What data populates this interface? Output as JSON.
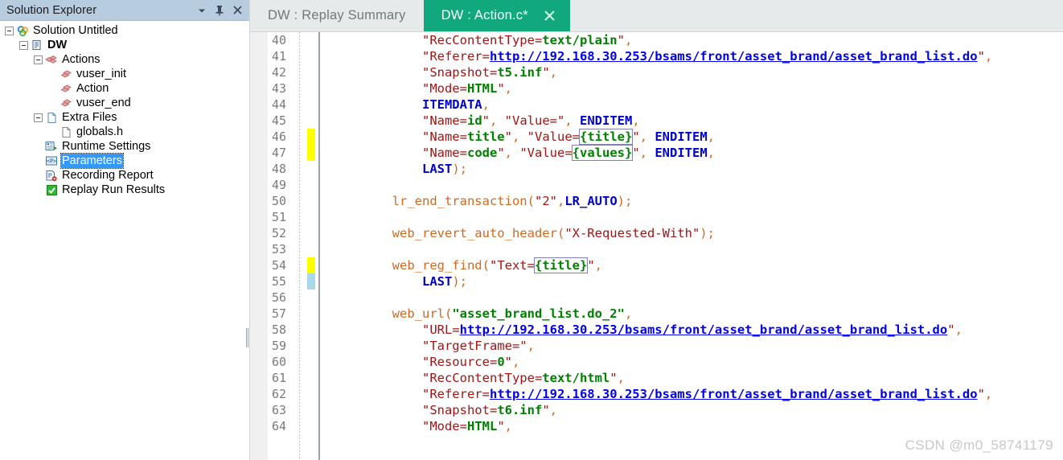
{
  "solution_explorer": {
    "title": "Solution Explorer",
    "header_buttons": [
      {
        "name": "dropdown-icon",
        "glyph": "▾"
      },
      {
        "name": "pin-icon",
        "glyph": "⚲"
      },
      {
        "name": "close-icon",
        "glyph": "✕"
      }
    ],
    "tree": [
      {
        "label": "Solution Untitled",
        "icon": "solution-icon",
        "depth": 0,
        "expander": "collapse",
        "bold": false,
        "selected": false
      },
      {
        "label": "DW",
        "icon": "script-icon",
        "depth": 1,
        "expander": "collapse",
        "bold": true,
        "selected": false
      },
      {
        "label": "Actions",
        "icon": "actions-folder-icon",
        "depth": 2,
        "expander": "collapse",
        "bold": false,
        "selected": false
      },
      {
        "label": "vuser_init",
        "icon": "action-block-icon",
        "depth": 3,
        "expander": "none",
        "bold": false,
        "selected": false
      },
      {
        "label": "Action",
        "icon": "action-block-icon",
        "depth": 3,
        "expander": "none",
        "bold": false,
        "selected": false
      },
      {
        "label": "vuser_end",
        "icon": "action-block-icon",
        "depth": 3,
        "expander": "none",
        "bold": false,
        "selected": false
      },
      {
        "label": "Extra Files",
        "icon": "extra-files-icon",
        "depth": 2,
        "expander": "collapse",
        "bold": false,
        "selected": false
      },
      {
        "label": "globals.h",
        "icon": "header-file-icon",
        "depth": 3,
        "expander": "none",
        "bold": false,
        "selected": false
      },
      {
        "label": "Runtime Settings",
        "icon": "runtime-settings-icon",
        "depth": 2,
        "expander": "none",
        "bold": false,
        "selected": false
      },
      {
        "label": "Parameters",
        "icon": "parameters-icon",
        "depth": 2,
        "expander": "none",
        "bold": false,
        "selected": true
      },
      {
        "label": "Recording Report",
        "icon": "recording-report-icon",
        "depth": 2,
        "expander": "none",
        "bold": false,
        "selected": false
      },
      {
        "label": "Replay Run Results",
        "icon": "replay-results-icon",
        "depth": 2,
        "expander": "none",
        "bold": false,
        "selected": false
      }
    ]
  },
  "tabs": [
    {
      "label": "DW : Replay Summary",
      "active": false,
      "closable": false
    },
    {
      "label": "DW : Action.c*",
      "active": true,
      "closable": true,
      "close_glyph": "✕"
    }
  ],
  "editor": {
    "first_line": 40,
    "lines": [
      {
        "n": 40,
        "marker": "none",
        "tokens": [
          {
            "t": "            ",
            "c": "t-plain"
          },
          {
            "t": "\"RecContentType=",
            "c": "t-str"
          },
          {
            "t": "text/plain",
            "c": "t-strv"
          },
          {
            "t": "\"",
            "c": "t-str"
          },
          {
            "t": ",",
            "c": "t-punct"
          }
        ]
      },
      {
        "n": 41,
        "marker": "none",
        "tokens": [
          {
            "t": "            ",
            "c": "t-plain"
          },
          {
            "t": "\"Referer=",
            "c": "t-str"
          },
          {
            "t": "http://192.168.30.253/bsams/front/asset_brand/asset_brand_list.do",
            "c": "t-url"
          },
          {
            "t": "\"",
            "c": "t-str"
          },
          {
            "t": ",",
            "c": "t-punct"
          }
        ]
      },
      {
        "n": 42,
        "marker": "none",
        "tokens": [
          {
            "t": "            ",
            "c": "t-plain"
          },
          {
            "t": "\"Snapshot=",
            "c": "t-str"
          },
          {
            "t": "t5.inf",
            "c": "t-strv"
          },
          {
            "t": "\"",
            "c": "t-str"
          },
          {
            "t": ",",
            "c": "t-punct"
          }
        ]
      },
      {
        "n": 43,
        "marker": "none",
        "tokens": [
          {
            "t": "            ",
            "c": "t-plain"
          },
          {
            "t": "\"Mode=",
            "c": "t-str"
          },
          {
            "t": "HTML",
            "c": "t-strv"
          },
          {
            "t": "\"",
            "c": "t-str"
          },
          {
            "t": ",",
            "c": "t-punct"
          }
        ]
      },
      {
        "n": 44,
        "marker": "none",
        "tokens": [
          {
            "t": "            ",
            "c": "t-plain"
          },
          {
            "t": "ITEMDATA",
            "c": "t-kw"
          },
          {
            "t": ",",
            "c": "t-punct"
          }
        ]
      },
      {
        "n": 45,
        "marker": "none",
        "tokens": [
          {
            "t": "            ",
            "c": "t-plain"
          },
          {
            "t": "\"Name=",
            "c": "t-str"
          },
          {
            "t": "id",
            "c": "t-strv"
          },
          {
            "t": "\"",
            "c": "t-str"
          },
          {
            "t": ", ",
            "c": "t-punct"
          },
          {
            "t": "\"Value=\"",
            "c": "t-str"
          },
          {
            "t": ", ",
            "c": "t-punct"
          },
          {
            "t": "ENDITEM",
            "c": "t-kw"
          },
          {
            "t": ",",
            "c": "t-punct"
          }
        ]
      },
      {
        "n": 46,
        "marker": "yellow",
        "tokens": [
          {
            "t": "            ",
            "c": "t-plain"
          },
          {
            "t": "\"Name=",
            "c": "t-str"
          },
          {
            "t": "title",
            "c": "t-strv"
          },
          {
            "t": "\"",
            "c": "t-str"
          },
          {
            "t": ", ",
            "c": "t-punct"
          },
          {
            "t": "\"Value=",
            "c": "t-str"
          },
          {
            "t": "{title}",
            "c": "t-param"
          },
          {
            "t": "\"",
            "c": "t-str"
          },
          {
            "t": ", ",
            "c": "t-punct"
          },
          {
            "t": "ENDITEM",
            "c": "t-kw"
          },
          {
            "t": ",",
            "c": "t-punct"
          }
        ]
      },
      {
        "n": 47,
        "marker": "yellow",
        "tokens": [
          {
            "t": "            ",
            "c": "t-plain"
          },
          {
            "t": "\"Name=",
            "c": "t-str"
          },
          {
            "t": "code",
            "c": "t-strv"
          },
          {
            "t": "\"",
            "c": "t-str"
          },
          {
            "t": ", ",
            "c": "t-punct"
          },
          {
            "t": "\"Value=",
            "c": "t-str"
          },
          {
            "t": "{values}",
            "c": "t-param"
          },
          {
            "t": "\"",
            "c": "t-str"
          },
          {
            "t": ", ",
            "c": "t-punct"
          },
          {
            "t": "ENDITEM",
            "c": "t-kw"
          },
          {
            "t": ",",
            "c": "t-punct"
          }
        ]
      },
      {
        "n": 48,
        "marker": "none",
        "tokens": [
          {
            "t": "            ",
            "c": "t-plain"
          },
          {
            "t": "LAST",
            "c": "t-kw"
          },
          {
            "t": ");",
            "c": "t-punct"
          }
        ]
      },
      {
        "n": 49,
        "marker": "none",
        "tokens": []
      },
      {
        "n": 50,
        "marker": "none",
        "tokens": [
          {
            "t": "        ",
            "c": "t-plain"
          },
          {
            "t": "lr_end_transaction",
            "c": "t-fn"
          },
          {
            "t": "(",
            "c": "t-punct"
          },
          {
            "t": "\"2\"",
            "c": "t-str"
          },
          {
            "t": ",",
            "c": "t-punct"
          },
          {
            "t": "LR_AUTO",
            "c": "t-kw"
          },
          {
            "t": ");",
            "c": "t-punct"
          }
        ]
      },
      {
        "n": 51,
        "marker": "none",
        "tokens": []
      },
      {
        "n": 52,
        "marker": "none",
        "tokens": [
          {
            "t": "        ",
            "c": "t-plain"
          },
          {
            "t": "web_revert_auto_header",
            "c": "t-fn"
          },
          {
            "t": "(",
            "c": "t-punct"
          },
          {
            "t": "\"X-Requested-With\"",
            "c": "t-str"
          },
          {
            "t": ");",
            "c": "t-punct"
          }
        ]
      },
      {
        "n": 53,
        "marker": "none",
        "tokens": []
      },
      {
        "n": 54,
        "marker": "yellow",
        "tokens": [
          {
            "t": "        ",
            "c": "t-plain"
          },
          {
            "t": "web_reg_find",
            "c": "t-fn"
          },
          {
            "t": "(",
            "c": "t-punct"
          },
          {
            "t": "\"Text=",
            "c": "t-str"
          },
          {
            "t": "{title}",
            "c": "t-param"
          },
          {
            "t": "\"",
            "c": "t-str"
          },
          {
            "t": ",",
            "c": "t-punct"
          }
        ]
      },
      {
        "n": 55,
        "marker": "blue",
        "tokens": [
          {
            "t": "            ",
            "c": "t-plain"
          },
          {
            "t": "LAST",
            "c": "t-kw"
          },
          {
            "t": ");",
            "c": "t-punct"
          }
        ]
      },
      {
        "n": 56,
        "marker": "none",
        "tokens": []
      },
      {
        "n": 57,
        "marker": "none",
        "tokens": [
          {
            "t": "        ",
            "c": "t-plain"
          },
          {
            "t": "web_url",
            "c": "t-fn"
          },
          {
            "t": "(",
            "c": "t-punct"
          },
          {
            "t": "\"asset_brand_list.do_2\"",
            "c": "t-strv"
          },
          {
            "t": ",",
            "c": "t-punct"
          }
        ]
      },
      {
        "n": 58,
        "marker": "none",
        "tokens": [
          {
            "t": "            ",
            "c": "t-plain"
          },
          {
            "t": "\"URL=",
            "c": "t-str"
          },
          {
            "t": "http://192.168.30.253/bsams/front/asset_brand/asset_brand_list.do",
            "c": "t-url"
          },
          {
            "t": "\"",
            "c": "t-str"
          },
          {
            "t": ",",
            "c": "t-punct"
          }
        ]
      },
      {
        "n": 59,
        "marker": "none",
        "tokens": [
          {
            "t": "            ",
            "c": "t-plain"
          },
          {
            "t": "\"TargetFrame=\"",
            "c": "t-str"
          },
          {
            "t": ",",
            "c": "t-punct"
          }
        ]
      },
      {
        "n": 60,
        "marker": "none",
        "tokens": [
          {
            "t": "            ",
            "c": "t-plain"
          },
          {
            "t": "\"Resource=",
            "c": "t-str"
          },
          {
            "t": "0",
            "c": "t-strv"
          },
          {
            "t": "\"",
            "c": "t-str"
          },
          {
            "t": ",",
            "c": "t-punct"
          }
        ]
      },
      {
        "n": 61,
        "marker": "none",
        "tokens": [
          {
            "t": "            ",
            "c": "t-plain"
          },
          {
            "t": "\"RecContentType=",
            "c": "t-str"
          },
          {
            "t": "text/html",
            "c": "t-strv"
          },
          {
            "t": "\"",
            "c": "t-str"
          },
          {
            "t": ",",
            "c": "t-punct"
          }
        ]
      },
      {
        "n": 62,
        "marker": "none",
        "tokens": [
          {
            "t": "            ",
            "c": "t-plain"
          },
          {
            "t": "\"Referer=",
            "c": "t-str"
          },
          {
            "t": "http://192.168.30.253/bsams/front/asset_brand/asset_brand_list.do",
            "c": "t-url"
          },
          {
            "t": "\"",
            "c": "t-str"
          },
          {
            "t": ",",
            "c": "t-punct"
          }
        ]
      },
      {
        "n": 63,
        "marker": "none",
        "tokens": [
          {
            "t": "            ",
            "c": "t-plain"
          },
          {
            "t": "\"Snapshot=",
            "c": "t-str"
          },
          {
            "t": "t6.inf",
            "c": "t-strv"
          },
          {
            "t": "\"",
            "c": "t-str"
          },
          {
            "t": ",",
            "c": "t-punct"
          }
        ]
      },
      {
        "n": 64,
        "marker": "none",
        "tokens": [
          {
            "t": "            ",
            "c": "t-plain"
          },
          {
            "t": "\"Mode=",
            "c": "t-str"
          },
          {
            "t": "HTML",
            "c": "t-strv"
          },
          {
            "t": "\"",
            "c": "t-str"
          },
          {
            "t": ",",
            "c": "t-punct"
          }
        ]
      }
    ]
  },
  "watermark": "CSDN @m0_58741179",
  "colors": {
    "accent_tab": "#10a87c",
    "panel_header": "#b8cce0",
    "selection": "#3399ff",
    "change_unsaved": "#ffff00",
    "change_saved": "#a9d8e8"
  }
}
